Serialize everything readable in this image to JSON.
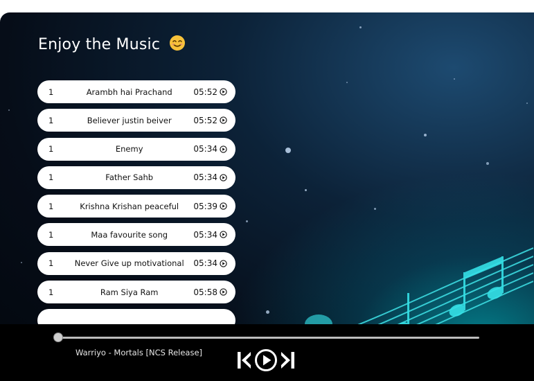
{
  "page": {
    "title": "Enjoy the Music",
    "title_emoji": "smiling-face-icon"
  },
  "songs": [
    {
      "index": "1",
      "name": "Arambh hai Prachand",
      "duration": "05:52"
    },
    {
      "index": "1",
      "name": "Believer justin beiver",
      "duration": "05:52"
    },
    {
      "index": "1",
      "name": "Enemy",
      "duration": "05:34"
    },
    {
      "index": "1",
      "name": "Father Sahb",
      "duration": "05:34"
    },
    {
      "index": "1",
      "name": "Krishna Krishan peaceful",
      "duration": "05:39"
    },
    {
      "index": "1",
      "name": "Maa favourite song",
      "duration": "05:34"
    },
    {
      "index": "1",
      "name": "Never Give up motivational",
      "duration": "05:34"
    },
    {
      "index": "1",
      "name": "Ram Siya Ram",
      "duration": "05:58"
    }
  ],
  "player": {
    "now_playing": "Warriyo - Mortals [NCS Release]",
    "progress": 0,
    "icons": [
      "skip-previous-icon",
      "play-icon",
      "skip-next-icon"
    ]
  },
  "colors": {
    "background": "#060d18",
    "accent_glow": "#00d2dc",
    "song_item_bg": "#ffffff",
    "player_bar": "#000000"
  }
}
